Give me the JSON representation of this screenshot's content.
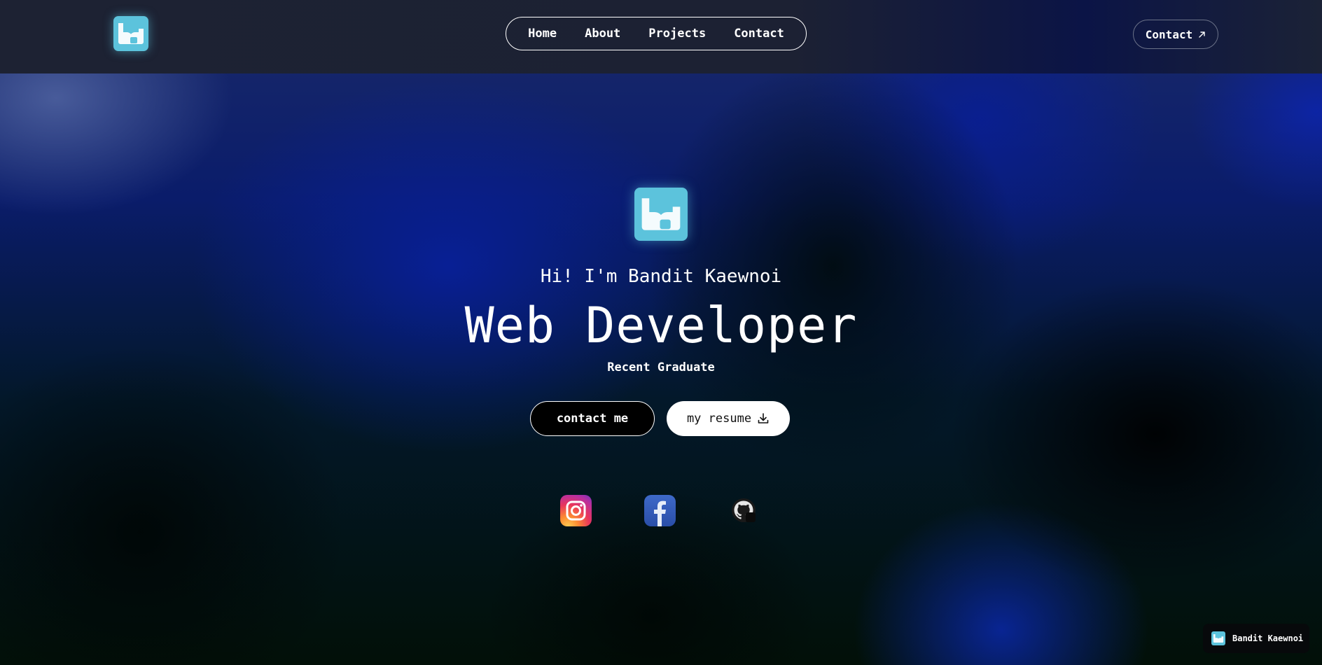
{
  "header": {
    "logo_icon": "bd-logo-icon",
    "nav": [
      {
        "label": "Home"
      },
      {
        "label": "About"
      },
      {
        "label": "Projects"
      },
      {
        "label": "Contact"
      }
    ],
    "contact_label": "Contact",
    "contact_icon": "arrow-up-right-icon"
  },
  "hero": {
    "logo_icon": "bd-logo-icon",
    "greeting": "Hi! I'm Bandit Kaewnoi",
    "title": "Web Developer",
    "subtitle": "Recent Graduate",
    "contact_button": "contact me",
    "resume_button": "my resume",
    "resume_icon": "download-icon"
  },
  "social": [
    {
      "name": "instagram-icon"
    },
    {
      "name": "facebook-icon"
    },
    {
      "name": "github-icon"
    }
  ],
  "badge": {
    "name": "Bandit Kaewnoi"
  },
  "colors": {
    "accent": "#5cc3dc",
    "header_bg": "#1d2233",
    "button_dark": "#000000",
    "button_light": "#ffffff"
  }
}
